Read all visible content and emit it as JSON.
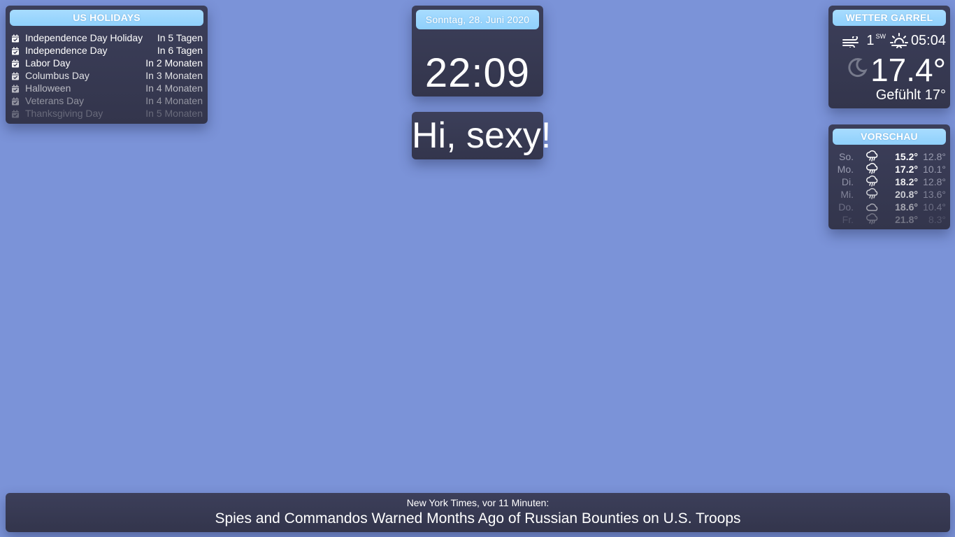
{
  "holidays": {
    "title": "US HOLIDAYS",
    "icon": "calendar-check-icon",
    "items": [
      {
        "name": "Independence Day Holiday",
        "when": "In 5 Tagen",
        "opacity": 1.0
      },
      {
        "name": "Independence Day",
        "when": "In 6 Tagen",
        "opacity": 1.0
      },
      {
        "name": "Labor Day",
        "when": "In 2 Monaten",
        "opacity": 1.0
      },
      {
        "name": "Columbus Day",
        "when": "In 3 Monaten",
        "opacity": 0.85
      },
      {
        "name": "Halloween",
        "when": "In 4 Monaten",
        "opacity": 0.65
      },
      {
        "name": "Veterans Day",
        "when": "In 4 Monaten",
        "opacity": 0.45
      },
      {
        "name": "Thanksgiving Day",
        "when": "In 5 Monaten",
        "opacity": 0.25
      }
    ]
  },
  "clock": {
    "date": "Sonntag, 28. Juni 2020",
    "time": "22:09"
  },
  "compliment": {
    "text": "Hi, sexy!"
  },
  "weather": {
    "title": "WETTER GARREL",
    "wind_icon": "wind-icon",
    "wind_speed": "1",
    "wind_direction": "SW",
    "sunrise_icon": "sunrise-icon",
    "sunrise_time": "05:04",
    "condition_icon": "moon-icon",
    "temperature": "17.4°",
    "feels_like": "Gefühlt 17°"
  },
  "forecast": {
    "title": "VORSCHAU",
    "days": [
      {
        "day": "So.",
        "icon": "rain-cloud-icon",
        "max": "15.2°",
        "min": "12.8°",
        "opacity": 1.0
      },
      {
        "day": "Mo.",
        "icon": "rain-cloud-icon",
        "max": "17.2°",
        "min": "10.1°",
        "opacity": 1.0
      },
      {
        "day": "Di.",
        "icon": "rain-cloud-icon",
        "max": "18.2°",
        "min": "12.8°",
        "opacity": 0.9
      },
      {
        "day": "Mi.",
        "icon": "rain-cloud-icon",
        "max": "20.8°",
        "min": "13.6°",
        "opacity": 0.75
      },
      {
        "day": "Do.",
        "icon": "cloud-icon",
        "max": "18.6°",
        "min": "10.4°",
        "opacity": 0.55
      },
      {
        "day": "Fr.",
        "icon": "rain-cloud-icon",
        "max": "21.8°",
        "min": "8.3°",
        "opacity": 0.3
      }
    ]
  },
  "news": {
    "source": "New York Times, vor 11 Minuten:",
    "headline": "Spies and Commandos Warned Months Ago of Russian Bounties on U.S. Troops"
  },
  "colors": {
    "background": "#7b93d8",
    "panel": "#3a3c55",
    "header": "#9fd8fc"
  }
}
